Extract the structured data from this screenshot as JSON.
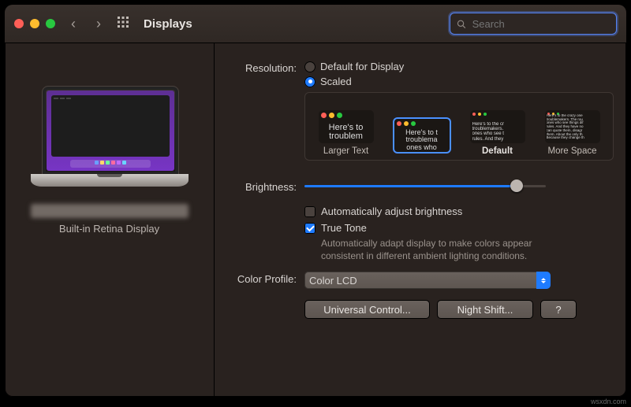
{
  "window": {
    "title": "Displays",
    "search_placeholder": "Search"
  },
  "sidebar": {
    "display_name": "Built-in Retina Display"
  },
  "resolution": {
    "label": "Resolution:",
    "opt_default": "Default for Display",
    "opt_scaled": "Scaled",
    "selected": "Scaled",
    "thumbs": [
      {
        "caption": "Larger Text",
        "sample": "Here's to troublem"
      },
      {
        "caption": "",
        "sample": "Here's to t\ntroublema\nones who"
      },
      {
        "caption": "Default",
        "sample": "Here's to the cr\ntroublemakers.\nones who see t\nrules. And they"
      },
      {
        "caption": "More Space",
        "sample": "Here's to the crazy one\ntroublemakers. The rou\nones who see things dif\nrules. And they have no\ncan quote them, disagr\nthem. About the only th\nBecause they change th"
      }
    ]
  },
  "brightness": {
    "label": "Brightness:",
    "value_pct": 88,
    "auto_label": "Automatically adjust brightness",
    "auto_checked": false,
    "truetone_label": "True Tone",
    "truetone_checked": true,
    "truetone_desc": "Automatically adapt display to make colors appear consistent in different ambient lighting conditions."
  },
  "color_profile": {
    "label": "Color Profile:",
    "value": "Color LCD"
  },
  "buttons": {
    "universal": "Universal Control...",
    "night_shift": "Night Shift...",
    "help": "?"
  },
  "watermark": "wsxdn.com"
}
